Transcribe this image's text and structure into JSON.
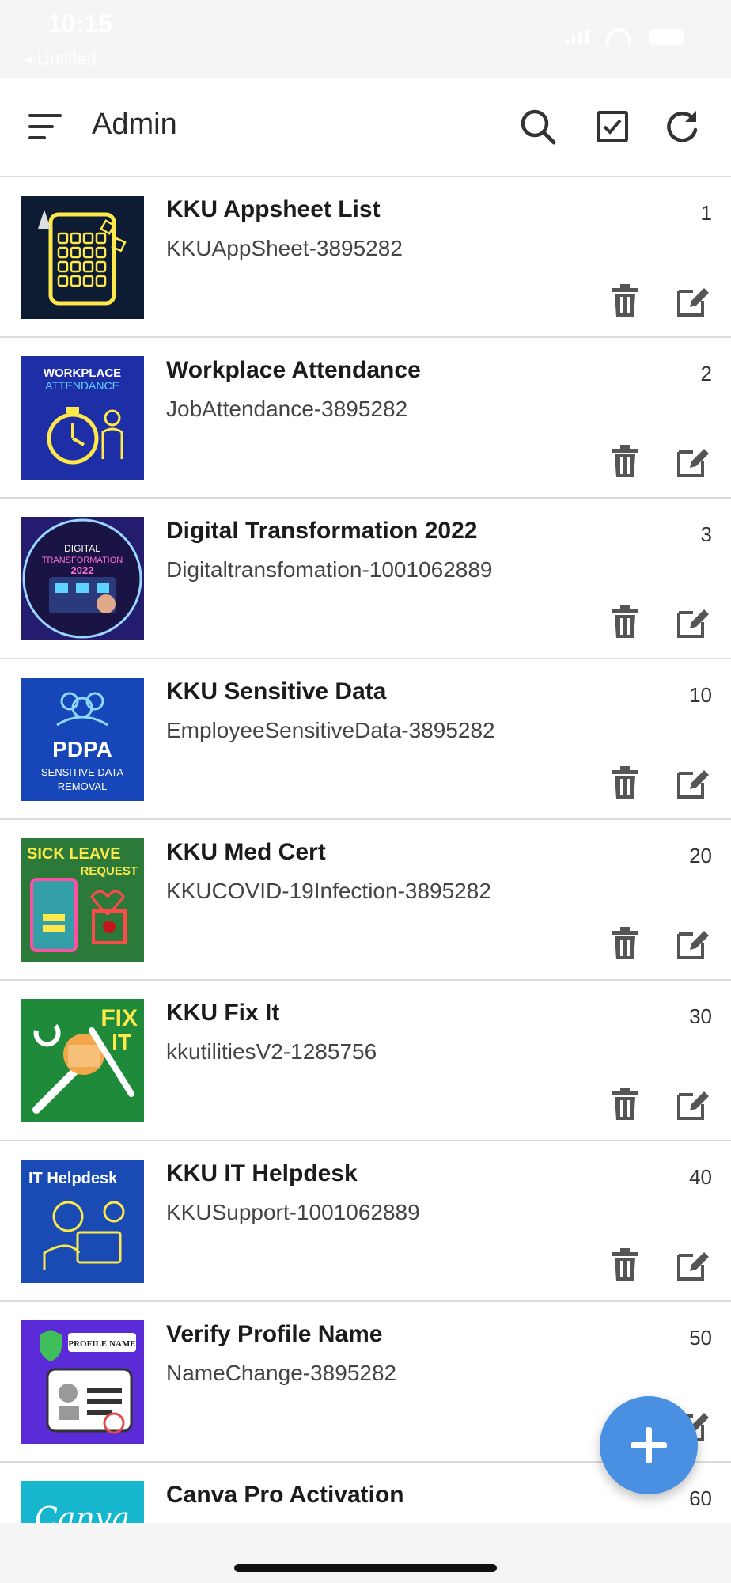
{
  "status_bar": {
    "time": "10:15",
    "back_label": "◂ Untitled"
  },
  "appbar": {
    "title": "Admin",
    "icons": [
      "menu-icon",
      "search-icon",
      "checkbox-icon",
      "refresh-icon"
    ]
  },
  "items": [
    {
      "title": "KKU Appsheet List",
      "subtitle": "KKUAppSheet-3895282",
      "number": "1",
      "thumb": "appsheet",
      "thumb_bg": "#0d1b33"
    },
    {
      "title": "Workplace Attendance",
      "subtitle": "JobAttendance-3895282",
      "number": "2",
      "thumb": "attendance",
      "thumb_bg": "#1d2ea6",
      "thumb_text": [
        "WORKPLACE",
        "ATTENDANCE"
      ]
    },
    {
      "title": "Digital Transformation 2022",
      "subtitle": "Digitaltransfomation-1001062889",
      "number": "3",
      "thumb": "digital",
      "thumb_bg": "#241c6e",
      "thumb_text": [
        "DIGITAL",
        "TRANSFORMATION",
        "2022"
      ]
    },
    {
      "title": "KKU Sensitive Data",
      "subtitle": "EmployeeSensitiveData-3895282",
      "number": "10",
      "thumb": "pdpa",
      "thumb_bg": "#1646b8",
      "thumb_text": [
        "PDPA",
        "SENSITIVE DATA",
        "REMOVAL"
      ]
    },
    {
      "title": "KKU Med Cert",
      "subtitle": "KKUCOVID-19Infection-3895282",
      "number": "20",
      "thumb": "sickleave",
      "thumb_bg": "#2c7a3a",
      "thumb_text": [
        "SICK LEAVE",
        "REQUEST"
      ]
    },
    {
      "title": "KKU Fix It",
      "subtitle": "kkutilitiesV2-1285756",
      "number": "30",
      "thumb": "fixit",
      "thumb_bg": "#1f8a3a",
      "thumb_text": [
        "FIX",
        "IT"
      ]
    },
    {
      "title": "KKU IT Helpdesk",
      "subtitle": "KKUSupport-1001062889",
      "number": "40",
      "thumb": "helpdesk",
      "thumb_bg": "#1a4bb5",
      "thumb_text": [
        "IT Helpdesk"
      ]
    },
    {
      "title": "Verify Profile Name",
      "subtitle": "NameChange-3895282",
      "number": "50",
      "thumb": "profile",
      "thumb_bg": "#5b2bd8",
      "thumb_text": [
        "PROFILE NAME"
      ]
    },
    {
      "title": "Canva Pro Activation",
      "subtitle": "",
      "number": "60",
      "thumb": "canva",
      "thumb_bg": "#17b6cf",
      "thumb_text": [
        "Canva"
      ]
    }
  ],
  "fab": {
    "icon": "plus-icon"
  },
  "colors": {
    "accent": "#4a90e2",
    "divider": "#dcdcdc",
    "icon_gray": "#555555"
  }
}
